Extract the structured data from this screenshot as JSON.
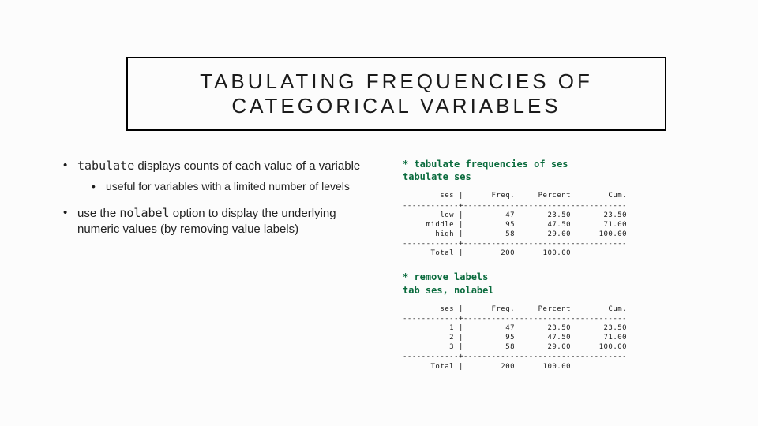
{
  "title": "TABULATING FREQUENCIES OF CATEGORICAL VARIABLES",
  "bullets": {
    "b1_pre": "tabulate",
    "b1_post": " displays counts of each value of a variable",
    "b1a": "useful for variables with a limited number of levels",
    "b2_pre": "use the ",
    "b2_mono": "nolabel",
    "b2_post": " option to display the underlying numeric values (by removing value labels)"
  },
  "code": {
    "c1_comment": "* tabulate frequencies of ses",
    "c1_cmd": "tabulate ses",
    "c2_comment": "* remove labels",
    "c2_cmd": "tab ses, nolabel"
  },
  "chart_data": [
    {
      "type": "table",
      "title": "tabulate ses",
      "columns": [
        "ses",
        "Freq.",
        "Percent",
        "Cum."
      ],
      "rows": [
        {
          "ses": "low",
          "freq": 47,
          "percent": 23.5,
          "cum": 23.5
        },
        {
          "ses": "middle",
          "freq": 95,
          "percent": 47.5,
          "cum": 71.0
        },
        {
          "ses": "high",
          "freq": 58,
          "percent": 29.0,
          "cum": 100.0
        }
      ],
      "total": {
        "freq": 200,
        "percent": 100.0
      }
    },
    {
      "type": "table",
      "title": "tab ses, nolabel",
      "columns": [
        "ses",
        "Freq.",
        "Percent",
        "Cum."
      ],
      "rows": [
        {
          "ses": "1",
          "freq": 47,
          "percent": 23.5,
          "cum": 23.5
        },
        {
          "ses": "2",
          "freq": 95,
          "percent": 47.5,
          "cum": 71.0
        },
        {
          "ses": "3",
          "freq": 58,
          "percent": 29.0,
          "cum": 100.0
        }
      ],
      "total": {
        "freq": 200,
        "percent": 100.0
      }
    }
  ],
  "tables": {
    "t1": "        ses |      Freq.     Percent        Cum.\n------------+-----------------------------------\n        low |         47       23.50       23.50\n     middle |         95       47.50       71.00\n       high |         58       29.00      100.00\n------------+-----------------------------------\n      Total |        200      100.00",
    "t2": "        ses |      Freq.     Percent        Cum.\n------------+-----------------------------------\n          1 |         47       23.50       23.50\n          2 |         95       47.50       71.00\n          3 |         58       29.00      100.00\n------------+-----------------------------------\n      Total |        200      100.00"
  }
}
